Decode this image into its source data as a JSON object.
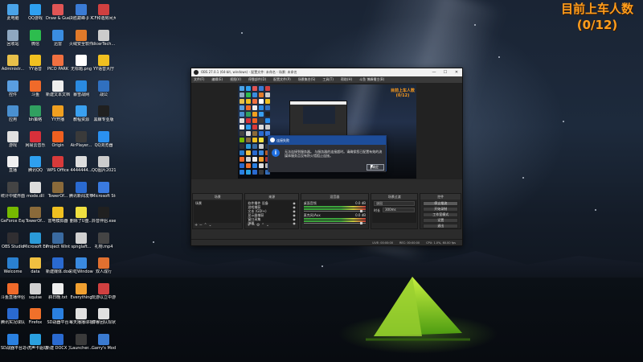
{
  "overlay": {
    "title": "目前上车人数",
    "count": "(0/12)"
  },
  "desktop_icons": [
    {
      "label": "此电脑",
      "color": "#4aa3e8"
    },
    {
      "label": "QQ游戏",
      "color": "#2ea0f0"
    },
    {
      "label": "Draw & Guess",
      "color": "#e05555"
    },
    {
      "label": "决胜巅峰-Ji X助手",
      "color": "#3a7bd5"
    },
    {
      "label": "CF和谐房间大厅",
      "color": "#d04040"
    },
    {
      "label": "回收站",
      "color": "#8fa8c0"
    },
    {
      "label": "微信",
      "color": "#2dbd4e"
    },
    {
      "label": "迅雷",
      "color": "#3a8de0"
    },
    {
      "label": "火绒安全软件",
      "color": "#e07a2a"
    },
    {
      "label": "dicerTech...",
      "color": "#cccccc"
    },
    {
      "label": "Administr...",
      "color": "#e8c04a"
    },
    {
      "label": "YY语音",
      "color": "#f0c020"
    },
    {
      "label": "PICO PARK",
      "color": "#f07040"
    },
    {
      "label": "无标题.png",
      "color": "#ffffff"
    },
    {
      "label": "YY语音大厅",
      "color": "#f0c020"
    },
    {
      "label": "控件",
      "color": "#5a9ee0"
    },
    {
      "label": "斗鱼",
      "color": "#f06a2a"
    },
    {
      "label": "新建文本文档.txt",
      "color": "#eeeeee"
    },
    {
      "label": "暴雪战网",
      "color": "#2a8ae0"
    },
    {
      "label": "战公",
      "color": "#3070c0"
    },
    {
      "label": "应用",
      "color": "#4a90d0"
    },
    {
      "label": "bh策略",
      "color": "#30a060"
    },
    {
      "label": "YY开播",
      "color": "#f0a020"
    },
    {
      "label": "教程资源",
      "color": "#3aa0f0"
    },
    {
      "label": "黑鲸专业版",
      "color": "#202020"
    },
    {
      "label": "游戏",
      "color": "#e0e0e0"
    },
    {
      "label": "网易云音乐",
      "color": "#d8303a"
    },
    {
      "label": "Origin",
      "color": "#f06020"
    },
    {
      "label": "AirPlayer...",
      "color": "#3a3a3a"
    },
    {
      "label": "QQ浏览器",
      "color": "#2a90f0"
    },
    {
      "label": "直播",
      "color": "#f0f0f0"
    },
    {
      "label": "腾讯QQ",
      "color": "#2ea0f0"
    },
    {
      "label": "WPS Office",
      "color": "#d83a3a"
    },
    {
      "label": "4444444...",
      "color": "#dddddd"
    },
    {
      "label": "QQ图片20210...",
      "color": "#cccccc"
    },
    {
      "label": "统计中键界面...mov",
      "color": "#444444"
    },
    {
      "label": "mode.dll",
      "color": "#dddddd"
    },
    {
      "label": "TowerOf...",
      "color": "#8a6a3a"
    },
    {
      "label": "腾讯新闻发布.doc",
      "color": "#2a6ad0"
    },
    {
      "label": "Microsoft Store",
      "color": "#3a7ae0"
    },
    {
      "label": "GeForce Experience",
      "color": "#76b900"
    },
    {
      "label": "TowerOf...",
      "color": "#8a6a3a"
    },
    {
      "label": "雷电模拟器",
      "color": "#f0c020"
    },
    {
      "label": "删除了U盘...",
      "color": "#f0e040"
    },
    {
      "label": "抖音伴侣.exe",
      "color": "#202020"
    },
    {
      "label": "OBS Studio",
      "color": "#302e31"
    },
    {
      "label": "Microsoft Edge",
      "color": "#2a9ad8"
    },
    {
      "label": "Project Winter",
      "color": "#3a6aa0"
    },
    {
      "label": "spnglaft...",
      "color": "#d0d0d0"
    },
    {
      "label": "礼物.mp4",
      "color": "#444444"
    },
    {
      "label": "Welcome",
      "color": "#2a80d0"
    },
    {
      "label": "data",
      "color": "#f0c040"
    },
    {
      "label": "新建媒体.doc",
      "color": "#2a6ad0"
    },
    {
      "label": "彩虹Windows...",
      "color": "#3a8ae0"
    },
    {
      "label": "双人成行",
      "color": "#e07030"
    },
    {
      "label": "斗鱼直播伴侣",
      "color": "#f06a2a"
    },
    {
      "label": "squise",
      "color": "#d0d0d0"
    },
    {
      "label": "斜日晚.txt",
      "color": "#eeeeee"
    },
    {
      "label": "Everything",
      "color": "#f0a030"
    },
    {
      "label": "玩游以立中游戏风格",
      "color": "#d04040"
    },
    {
      "label": "腾讯实况球队",
      "color": "#2a6ad0"
    },
    {
      "label": "Firefox",
      "color": "#f0702a"
    },
    {
      "label": "SD战器平台",
      "color": "#2a80e0"
    },
    {
      "label": "每天播播球视频助手",
      "color": "#e0e0e0"
    },
    {
      "label": "博睿团队现状文 底部...",
      "color": "#e0e0e0"
    },
    {
      "label": "SD战器平台2.0",
      "color": "#2a80e0"
    },
    {
      "label": "小虎声卡驱动助手",
      "color": "#2aa0e0"
    },
    {
      "label": "新建 DOCX 文档.docx",
      "color": "#2a6ad0"
    },
    {
      "label": "Launcher...",
      "color": "#3a3a3a"
    },
    {
      "label": "Garry's Mod",
      "color": "#3a7ad0"
    }
  ],
  "obs": {
    "window_title": "OBS 27.0.1 (64-bit, windows) - 配置文件: 未命名 - 场景: 未命名",
    "menu": [
      "文件(F)",
      "编辑(E)",
      "视图(V)",
      "停靠部件(D)",
      "配置文件(P)",
      "场景集合(S)",
      "工具(T)",
      "帮助(H)",
      "斗鱼 博峰播主(B)"
    ],
    "preview_counter": {
      "title": "目前上车人数",
      "count": "(0/12)"
    },
    "dialog": {
      "title": "连接失败",
      "message": "无法连接到服务器。    与服务器的连接超时。请确保您已配置有效的流媒体服务且没有防火墙阻止连接。",
      "ok_label": "确定"
    },
    "docks": {
      "scenes": {
        "title": "场景",
        "items": [
          "场景"
        ]
      },
      "sources": {
        "title": "来源",
        "items": [
          "软件播件 设备",
          "游戏捕获",
          "文本 (GDI+)",
          "显示器捕获",
          "窗口采集",
          "弹幕"
        ]
      },
      "mixer": {
        "title": "混音器",
        "channels": [
          {
            "name": "桌面音频",
            "level": "0.0 dB"
          },
          {
            "name": "麦克风/Aux",
            "level": "0.0 dB"
          }
        ]
      },
      "transitions": {
        "title": "场景过渡",
        "type": "淡出",
        "duration_label": "时长",
        "duration": "300ms"
      },
      "controls": {
        "title": "控件",
        "buttons": [
          "停止推流",
          "开始录制",
          "工作室模式",
          "设置",
          "退出"
        ]
      }
    },
    "status": [
      "LIVE: 00:00:00",
      "REC: 00:00:00",
      "CPU: 1.0%, 60.00 fps"
    ]
  }
}
